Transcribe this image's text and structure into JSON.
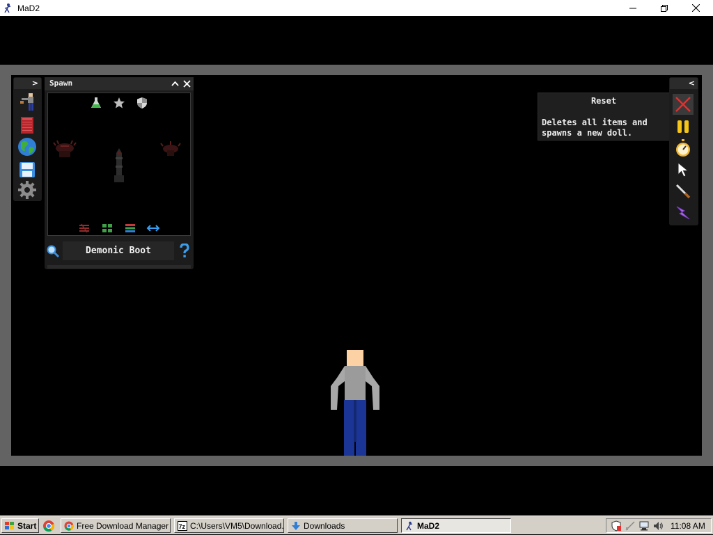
{
  "window": {
    "title": "MaD2"
  },
  "spawn": {
    "title": "Spawn",
    "search_value": "Demonic Boot"
  },
  "tooltip": {
    "title": "Reset",
    "body": "Deletes all items and spawns a new doll."
  },
  "taskbar": {
    "start_label": "Start",
    "tasks": [
      {
        "label": "Free Download Manager -..."
      },
      {
        "label": "C:\\Users\\VM5\\Download..."
      },
      {
        "label": "Downloads"
      },
      {
        "label": "MaD2"
      }
    ],
    "clock": "11:08 AM"
  },
  "colors": {
    "accent_close": "#e0302f",
    "pause": "#f5c518",
    "gold": "#f2b632",
    "lightning": "#b06cf0"
  }
}
